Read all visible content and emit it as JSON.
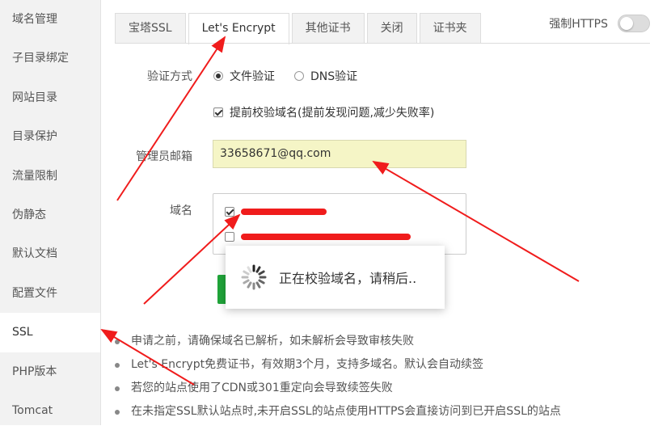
{
  "sidebar": {
    "items": [
      {
        "label": "域名管理"
      },
      {
        "label": "子目录绑定"
      },
      {
        "label": "网站目录"
      },
      {
        "label": "目录保护"
      },
      {
        "label": "流量限制"
      },
      {
        "label": "伪静态"
      },
      {
        "label": "默认文档"
      },
      {
        "label": "配置文件"
      },
      {
        "label": "SSL",
        "active": true
      },
      {
        "label": "PHP版本"
      },
      {
        "label": "Tomcat"
      }
    ]
  },
  "tabs": [
    {
      "label": "宝塔SSL"
    },
    {
      "label": "Let's Encrypt",
      "active": true
    },
    {
      "label": "其他证书"
    },
    {
      "label": "关闭"
    },
    {
      "label": "证书夹"
    }
  ],
  "force_https": {
    "label": "强制HTTPS",
    "enabled": false
  },
  "form": {
    "verify_label": "验证方式",
    "verify_options": [
      {
        "label": "文件验证",
        "checked": true
      },
      {
        "label": "DNS验证",
        "checked": false
      }
    ],
    "precheck_label": "提前校验域名(提前发现问题,减少失败率)",
    "precheck_checked": true,
    "email_label": "管理员邮箱",
    "email_value": "33658671@qq.com",
    "domain_label": "域名",
    "domains": [
      {
        "checked": true
      },
      {
        "checked": false
      }
    ]
  },
  "loading": {
    "text": "正在校验域名，请稍后.."
  },
  "notes": [
    "申请之前，请确保域名已解析，如未解析会导致审核失败",
    "Let's Encrypt免费证书，有效期3个月，支持多域名。默认会自动续签",
    "若您的站点使用了CDN或301重定向会导致续签失败",
    "在未指定SSL默认站点时,未开启SSL的站点使用HTTPS会直接访问到已开启SSL的站点"
  ],
  "colors": {
    "accent_green": "#20a53a",
    "annotation_red": "#f01c1c",
    "email_bg": "#f5f5c6"
  }
}
